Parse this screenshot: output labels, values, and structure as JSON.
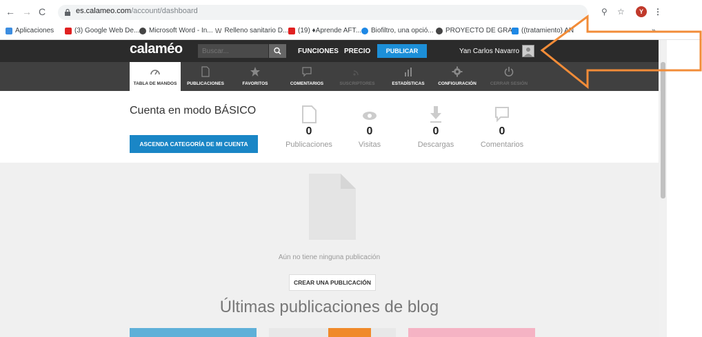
{
  "browser": {
    "url_host": "es.calameo.com",
    "url_path": "/account/dashboard",
    "profile_initial": "Y",
    "bookmarks": [
      {
        "label": "Aplicaciones",
        "color": "#3c8de0"
      },
      {
        "label": "(3) Google Web De...",
        "color": "#e02020"
      },
      {
        "label": "Microsoft Word - In...",
        "color": "#444444"
      },
      {
        "label": "Relleno sanitario D...",
        "color": "#555555"
      },
      {
        "label": "(19) ♦Aprende AFT...",
        "color": "#e02020"
      },
      {
        "label": "Biofiltro, una opció...",
        "color": "#1e88e5"
      },
      {
        "label": "PROYECTO DE GRA...",
        "color": "#444444"
      },
      {
        "label": "((tratamiento) AN",
        "color": "#1e88e5"
      }
    ],
    "overflow": "»"
  },
  "topbar": {
    "logo": "calaméo",
    "search_placeholder": "Buscar...",
    "funciones": "FUNCIONES",
    "precio": "PRECIO",
    "publicar": "PUBLICAR",
    "username": "Yan Carlos Navarro"
  },
  "tabs": [
    {
      "label": "TABLA DE MANDOS",
      "icon": "gauge-icon",
      "state": "active"
    },
    {
      "label": "PUBLICACIONES",
      "icon": "document-icon",
      "state": "normal"
    },
    {
      "label": "FAVORITOS",
      "icon": "star-icon",
      "state": "normal"
    },
    {
      "label": "COMENTARIOS",
      "icon": "comment-icon",
      "state": "normal"
    },
    {
      "label": "SUSCRIPTORES",
      "icon": "rss-icon",
      "state": "muted"
    },
    {
      "label": "ESTADÍSTICAS",
      "icon": "bar-chart-icon",
      "state": "normal"
    },
    {
      "label": "CONFIGURACIÓN",
      "icon": "gear-icon",
      "state": "normal"
    },
    {
      "label": "CERRAR SESIÓN",
      "icon": "power-icon",
      "state": "muted"
    }
  ],
  "account": {
    "title": "Cuenta en modo BÁSICO",
    "upgrade": "ASCENDA CATEGORÍA DE MI CUENTA"
  },
  "stats": [
    {
      "value": "0",
      "label": "Publicaciones",
      "icon": "document-icon"
    },
    {
      "value": "0",
      "label": "Visitas",
      "icon": "eye-icon"
    },
    {
      "value": "0",
      "label": "Descargas",
      "icon": "download-icon"
    },
    {
      "value": "0",
      "label": "Comentarios",
      "icon": "comment-icon"
    }
  ],
  "empty": {
    "message": "Aún no tiene ninguna publicación",
    "create": "CREAR UNA PUBLICACIÓN",
    "blog_title": "Últimas publicaciones de blog"
  },
  "colors": {
    "accent_blue": "#1c8fd8",
    "topbar": "#2b2b2b",
    "tabbar": "#404040",
    "arrow": "#f28c38"
  }
}
